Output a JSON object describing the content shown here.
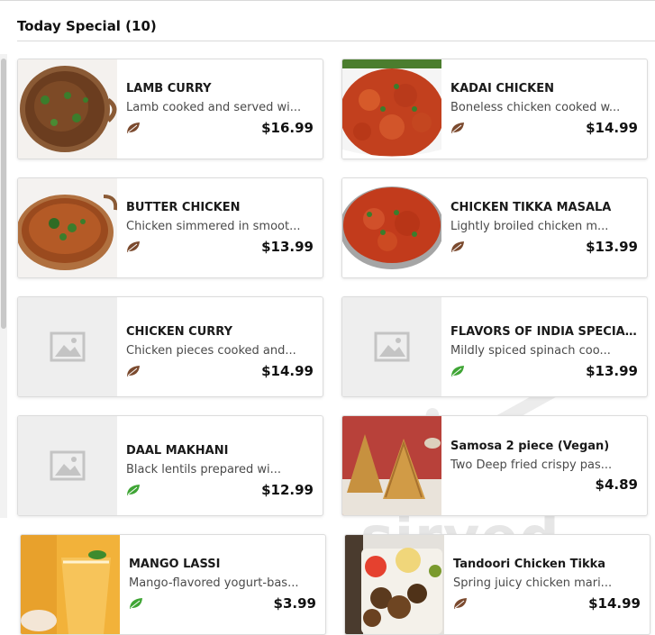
{
  "section": {
    "title": "Today Special (10)"
  },
  "watermark": "sirved",
  "colors": {
    "leaf_brown": "#7b4a2e",
    "leaf_green": "#3fa535",
    "placeholder": "#eeeeee"
  },
  "items": [
    {
      "name": "LAMB CURRY",
      "description": "Lamb cooked and served wi...",
      "price": "$16.99",
      "diet_icon": "leaf-brown-icon",
      "image": "curry-bowl-photo"
    },
    {
      "name": "KADAI CHICKEN",
      "description": "Boneless chicken cooked w...",
      "price": "$14.99",
      "diet_icon": "leaf-brown-icon",
      "image": "red-curry-photo"
    },
    {
      "name": "BUTTER CHICKEN",
      "description": "Chicken simmered in smoot...",
      "price": "$13.99",
      "diet_icon": "leaf-brown-icon",
      "image": "curry-bowl-photo"
    },
    {
      "name": "CHICKEN TIKKA MASALA",
      "description": "Lightly broiled chicken m...",
      "price": "$13.99",
      "diet_icon": "leaf-brown-icon",
      "image": "red-curry-photo"
    },
    {
      "name": "CHICKEN CURRY",
      "description": "Chicken pieces cooked and...",
      "price": "$14.99",
      "diet_icon": "leaf-brown-icon",
      "image": "placeholder-image-icon"
    },
    {
      "name": "FLAVORS OF INDIA SPECIAL ...",
      "description": "Mildly spiced spinach coo...",
      "price": "$13.99",
      "diet_icon": "leaf-green-icon",
      "image": "placeholder-image-icon"
    },
    {
      "name": "DAAL MAKHANI",
      "description": "Black lentils prepared wi...",
      "price": "$12.99",
      "diet_icon": "leaf-green-icon",
      "image": "placeholder-image-icon"
    },
    {
      "name": "Samosa 2 piece (Vegan)",
      "description": "Two Deep fried crispy pas...",
      "price": "$4.89",
      "diet_icon": "none",
      "image": "samosa-photo"
    },
    {
      "name": "MANGO LASSI",
      "description": "Mango-flavored yogurt-bas...",
      "price": "$3.99",
      "diet_icon": "leaf-green-icon",
      "image": "mango-lassi-photo"
    },
    {
      "name": "Tandoori Chicken Tikka",
      "description": "Spring juicy chicken mari...",
      "price": "$14.99",
      "diet_icon": "leaf-brown-icon",
      "image": "tandoori-photo"
    }
  ]
}
